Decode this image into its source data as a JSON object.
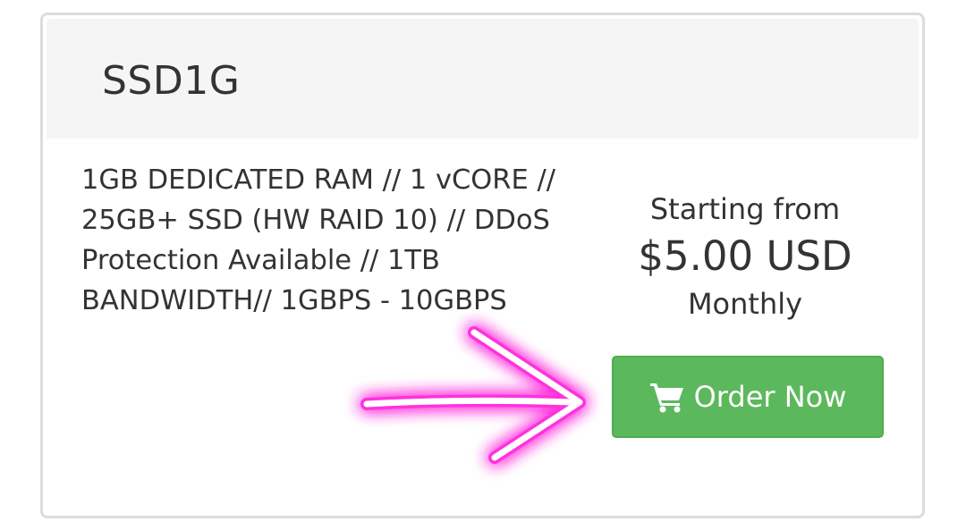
{
  "product": {
    "title": "SSD1G",
    "description": "1GB DEDICATED RAM // 1 vCORE // 25GB+ SSD (HW RAID 10) // DDoS Protection Available // 1TB BANDWIDTH// 1GBPS - 10GBPS"
  },
  "pricing": {
    "prefix": "Starting from",
    "amount": "$5.00 USD",
    "cycle": "Monthly"
  },
  "order_button": {
    "label": "Order Now",
    "icon": "shopping-cart-icon",
    "color": "#5cb85c"
  },
  "annotation": {
    "icon": "arrow-right-icon",
    "color": "#ff33dd"
  }
}
